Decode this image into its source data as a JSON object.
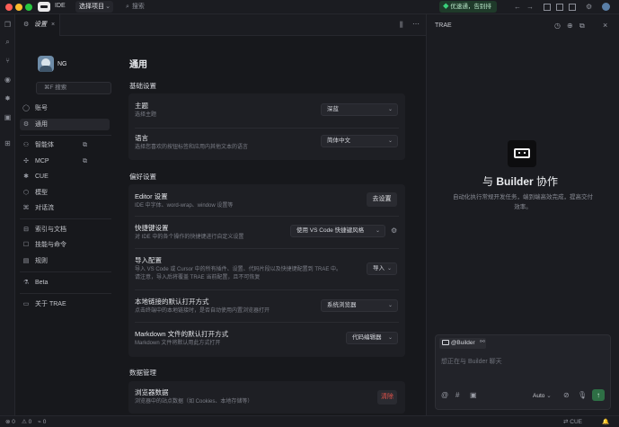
{
  "window": {
    "ide_label": "IDE",
    "project": "选择项目",
    "search_placeholder": "搜索",
    "upgrade": "优速通，告别排队"
  },
  "tab": {
    "label": "设置"
  },
  "user": {
    "name": "NG"
  },
  "nav": {
    "search": "⌘F 搜索",
    "items": [
      {
        "label": "账号",
        "icon": "user-icon"
      },
      {
        "label": "通用",
        "icon": "gear-icon"
      },
      {
        "label": "智能体",
        "icon": "agent-icon"
      },
      {
        "label": "MCP",
        "icon": "mcp-icon"
      },
      {
        "label": "CUE",
        "icon": "cue-icon"
      },
      {
        "label": "模型",
        "icon": "model-icon"
      },
      {
        "label": "对话流",
        "icon": "chat-icon"
      },
      {
        "label": "索引与文档",
        "icon": "index-icon"
      },
      {
        "label": "技能与命令",
        "icon": "skill-icon"
      },
      {
        "label": "规则",
        "icon": "rule-icon"
      },
      {
        "label": "Beta",
        "icon": "beta-icon"
      },
      {
        "label": "关于 TRAE",
        "icon": "info-icon"
      }
    ]
  },
  "content": {
    "title": "通用",
    "basic": {
      "heading": "基础设置",
      "theme": {
        "title": "主题",
        "desc": "选择主题",
        "value": "深蓝"
      },
      "lang": {
        "title": "语言",
        "desc": "选择您喜欢的按钮标签和应用内其他文本的语言",
        "value": "简体中文"
      }
    },
    "prefs": {
      "heading": "偏好设置",
      "editor": {
        "title": "Editor 设置",
        "desc": "IDE 中字体、word-wrap、window 设置等",
        "button": "去设置"
      },
      "keys": {
        "title": "快捷键设置",
        "desc": "对 IDE 中的各个操作的快捷键进行自定义设置",
        "value": "使用 VS Code 快捷键风格"
      },
      "import": {
        "title": "导入配置",
        "desc1": "导入 VS Code 或 Cursor 中的所有插件、设置、代码片段以及快捷键配置到 TRAE 中。",
        "desc2": "请注意，导入后将覆盖 TRAE 当前配置，且不可恢复",
        "button": "导入"
      },
      "browser": {
        "title": "本地链接的默认打开方式",
        "desc": "点击终端中的本地链接时，是否自动使用内置浏览器打开",
        "value": "系统浏览器"
      },
      "markdown": {
        "title": "Markdown 文件的默认打开方式",
        "desc": "Markdown 文件将默认用此方式打开",
        "value": "代码编辑器"
      }
    },
    "data": {
      "heading": "数据管理",
      "browserdata": {
        "title": "浏览器数据",
        "desc": "浏览器中的站点数据（如 Cookies、本地存储等）",
        "button": "清除"
      }
    }
  },
  "right": {
    "title": "TRAE",
    "heading_prefix": "与",
    "heading_name": "Builder",
    "heading_suffix": "协作",
    "desc1": "自动化执行常规开发任务，端到端高效完成，提高交付",
    "desc2": "效率。",
    "agent": "@Builder",
    "input_placeholder": "想正在与 Builder 聊天",
    "mode": "Auto"
  },
  "status": {
    "errors": "0",
    "warnings": "0",
    "cue": "CUE"
  }
}
